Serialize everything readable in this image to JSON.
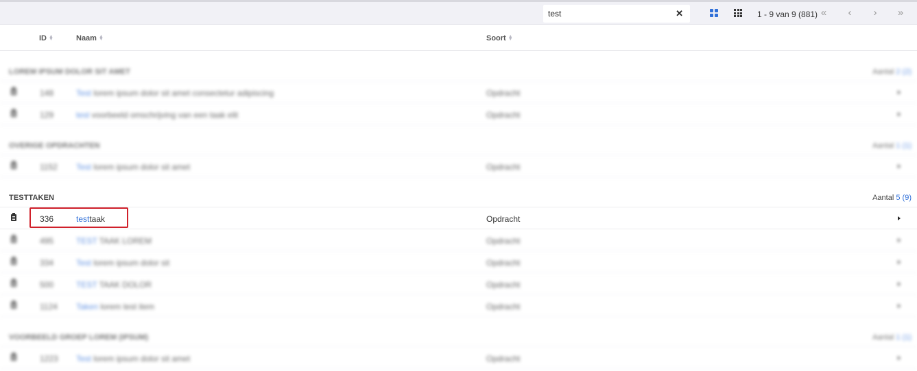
{
  "toolbar": {
    "search_value": "test",
    "clear_icon": "close-icon",
    "view_large_icon": "grid-large-icon",
    "view_small_icon": "grid-small-icon",
    "page_info": "1 - 9 van 9 (881)",
    "first_icon": "«",
    "prev_icon": "‹",
    "next_icon": "›",
    "last_icon": "»"
  },
  "columns": {
    "id": "ID",
    "name": "Naam",
    "type": "Soort"
  },
  "groups": [
    {
      "title": "Lorem ipsum dolor sit amet",
      "count_label": "Aantal",
      "count_value": "2",
      "count_total": "(2)",
      "blurred": true,
      "rows": [
        {
          "id": "148",
          "name_hl": "Test",
          "name_rest": " lorem ipsum dolor sit amet consectetur adipiscing",
          "type": "Opdracht"
        },
        {
          "id": "129",
          "name_hl": "test",
          "name_rest": " voorbeeld omschrijving van een taak elit",
          "type": "Opdracht"
        }
      ]
    },
    {
      "title": "Overige opdrachten",
      "count_label": "Aantal",
      "count_value": "1",
      "count_total": "(1)",
      "blurred": true,
      "rows": [
        {
          "id": "1152",
          "name_hl": "Test",
          "name_rest": " lorem ipsum dolor sit amet",
          "type": "Opdracht"
        }
      ]
    },
    {
      "title": "TESTTAKEN",
      "count_label": "Aantal",
      "count_value": "5",
      "count_total": "(9)",
      "blurred": false,
      "rows": [
        {
          "id": "336",
          "name_hl": "test",
          "name_rest": "taak",
          "type": "Opdracht",
          "visible": true
        },
        {
          "id": "495",
          "name_hl": "TEST",
          "name_rest": " TAAK LOREM",
          "type": "Opdracht",
          "visible": false
        },
        {
          "id": "334",
          "name_hl": "Test",
          "name_rest": " lorem ipsum dolor sit",
          "type": "Opdracht",
          "visible": false
        },
        {
          "id": "500",
          "name_hl": "TEST",
          "name_rest": " TAAK DOLOR",
          "type": "Opdracht",
          "visible": false
        },
        {
          "id": "1124",
          "name_hl": "Taken",
          "name_rest": " lorem test item",
          "type": "Opdracht",
          "visible": false
        }
      ]
    },
    {
      "title": "Voorbeeld groep lorem (ipsum)",
      "count_label": "Aantal",
      "count_value": "1",
      "count_total": "(1)",
      "blurred": true,
      "rows": [
        {
          "id": "1223",
          "name_hl": "Test",
          "name_rest": " lorem ipsum dolor sit amet",
          "type": "Opdracht"
        }
      ]
    }
  ]
}
